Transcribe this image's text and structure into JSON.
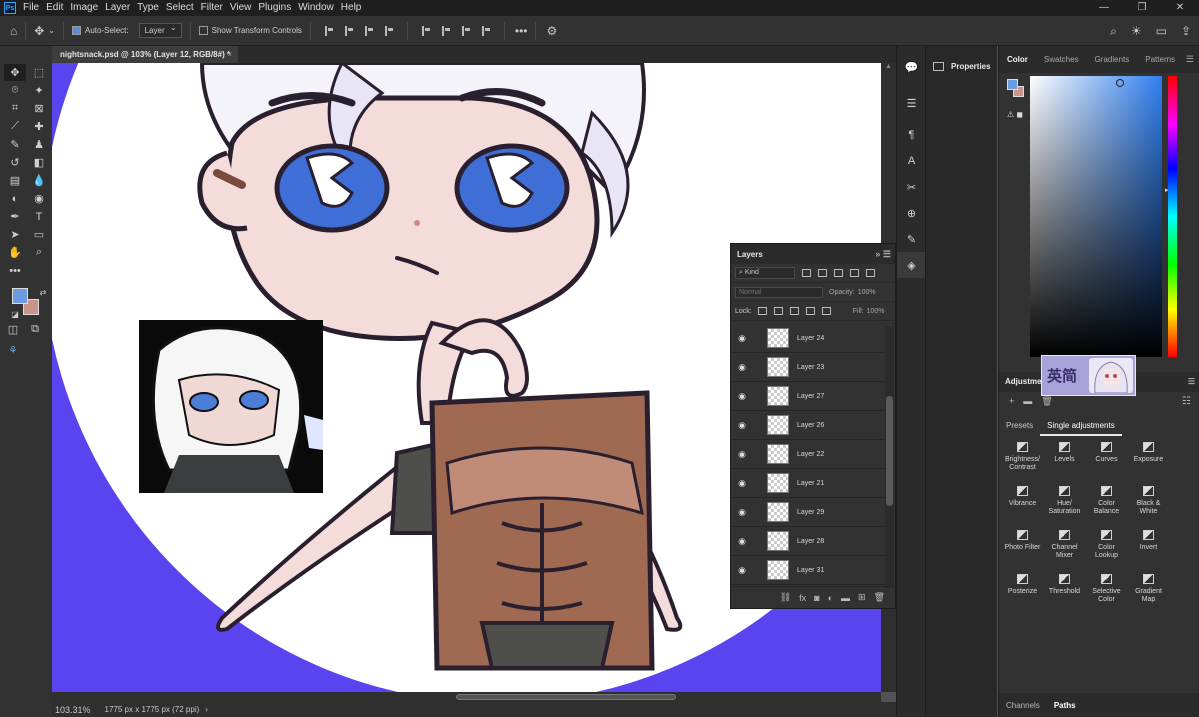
{
  "menubar": {
    "logo": "Ps",
    "items": [
      "File",
      "Edit",
      "Image",
      "Layer",
      "Type",
      "Select",
      "Filter",
      "View",
      "Plugins",
      "Window",
      "Help"
    ]
  },
  "options": {
    "auto_select_label": "Auto-Select:",
    "auto_select_target": "Layer",
    "show_transform_label": "Show Transform Controls"
  },
  "document": {
    "tab_title": "nightsnack.psd @ 103% (Layer 12, RGB/8#) *",
    "close": "×",
    "zoom": "103.31%",
    "size_info": "1775 px x 1775 px (72 ppi)"
  },
  "layers_panel": {
    "title": "Layers",
    "filter_kind": "Kind",
    "blend_mode": "Normal",
    "opacity_label": "Opacity:",
    "opacity_value": "100%",
    "lock_label": "Lock:",
    "fill_label": "Fill:",
    "fill_value": "100%",
    "layers": [
      "Layer 24",
      "Layer 23",
      "Layer 27",
      "Layer 26",
      "Layer 22",
      "Layer 21",
      "Layer 29",
      "Layer 28",
      "Layer 31"
    ]
  },
  "properties": {
    "title": "Properties"
  },
  "color_panel": {
    "tabs": [
      "Color",
      "Swatches",
      "Gradients",
      "Patterns"
    ],
    "foreground": "#6b9be0",
    "background": "#c9958a"
  },
  "adjustments": {
    "title": "Adjustments",
    "subtabs": [
      "Presets",
      "Single adjustments"
    ],
    "items": [
      "Brightness/ Contrast",
      "Levels",
      "Curves",
      "Exposure",
      "Vibrance",
      "Hue/ Saturation",
      "Color Balance",
      "Black & White",
      "Photo Filter",
      "Channel Mixer",
      "Color Lookup",
      "Invert",
      "Posterize",
      "Threshold",
      "Selective Color",
      "Gradient Map"
    ]
  },
  "bottom_tabs": [
    "Channels",
    "Paths"
  ],
  "ime": {
    "text": "英简"
  },
  "colors": {
    "canvas_bg": "#5a44f0",
    "skin": "#f3dcd9",
    "eyes": "#3f6fd6",
    "outline": "#2a1f2e"
  }
}
